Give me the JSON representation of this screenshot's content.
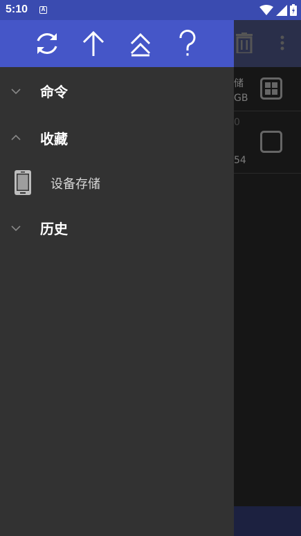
{
  "status_bar": {
    "time": "5:10",
    "notification_badge": "A",
    "icons": [
      "wifi-icon",
      "signal-icon",
      "battery-icon"
    ]
  },
  "background_app": {
    "row1_peek_line1": "储",
    "row1_peek_line2": "GB",
    "row2_peek_line1": "0",
    "row2_peek_line2": "54"
  },
  "drawer": {
    "header_icons": [
      "refresh-icon",
      "arrow-up-icon",
      "double-chevron-up-icon",
      "help-icon"
    ],
    "groups": [
      {
        "label": "命令",
        "expanded": false
      },
      {
        "label": "收藏",
        "expanded": true
      },
      {
        "label": "历史",
        "expanded": false
      }
    ],
    "favorites": [
      {
        "label": "设备存储",
        "icon": "phone-icon"
      }
    ]
  },
  "colors": {
    "header": "#4556c8",
    "status_bar": "#3a4bb0",
    "drawer_bg": "#323232"
  }
}
